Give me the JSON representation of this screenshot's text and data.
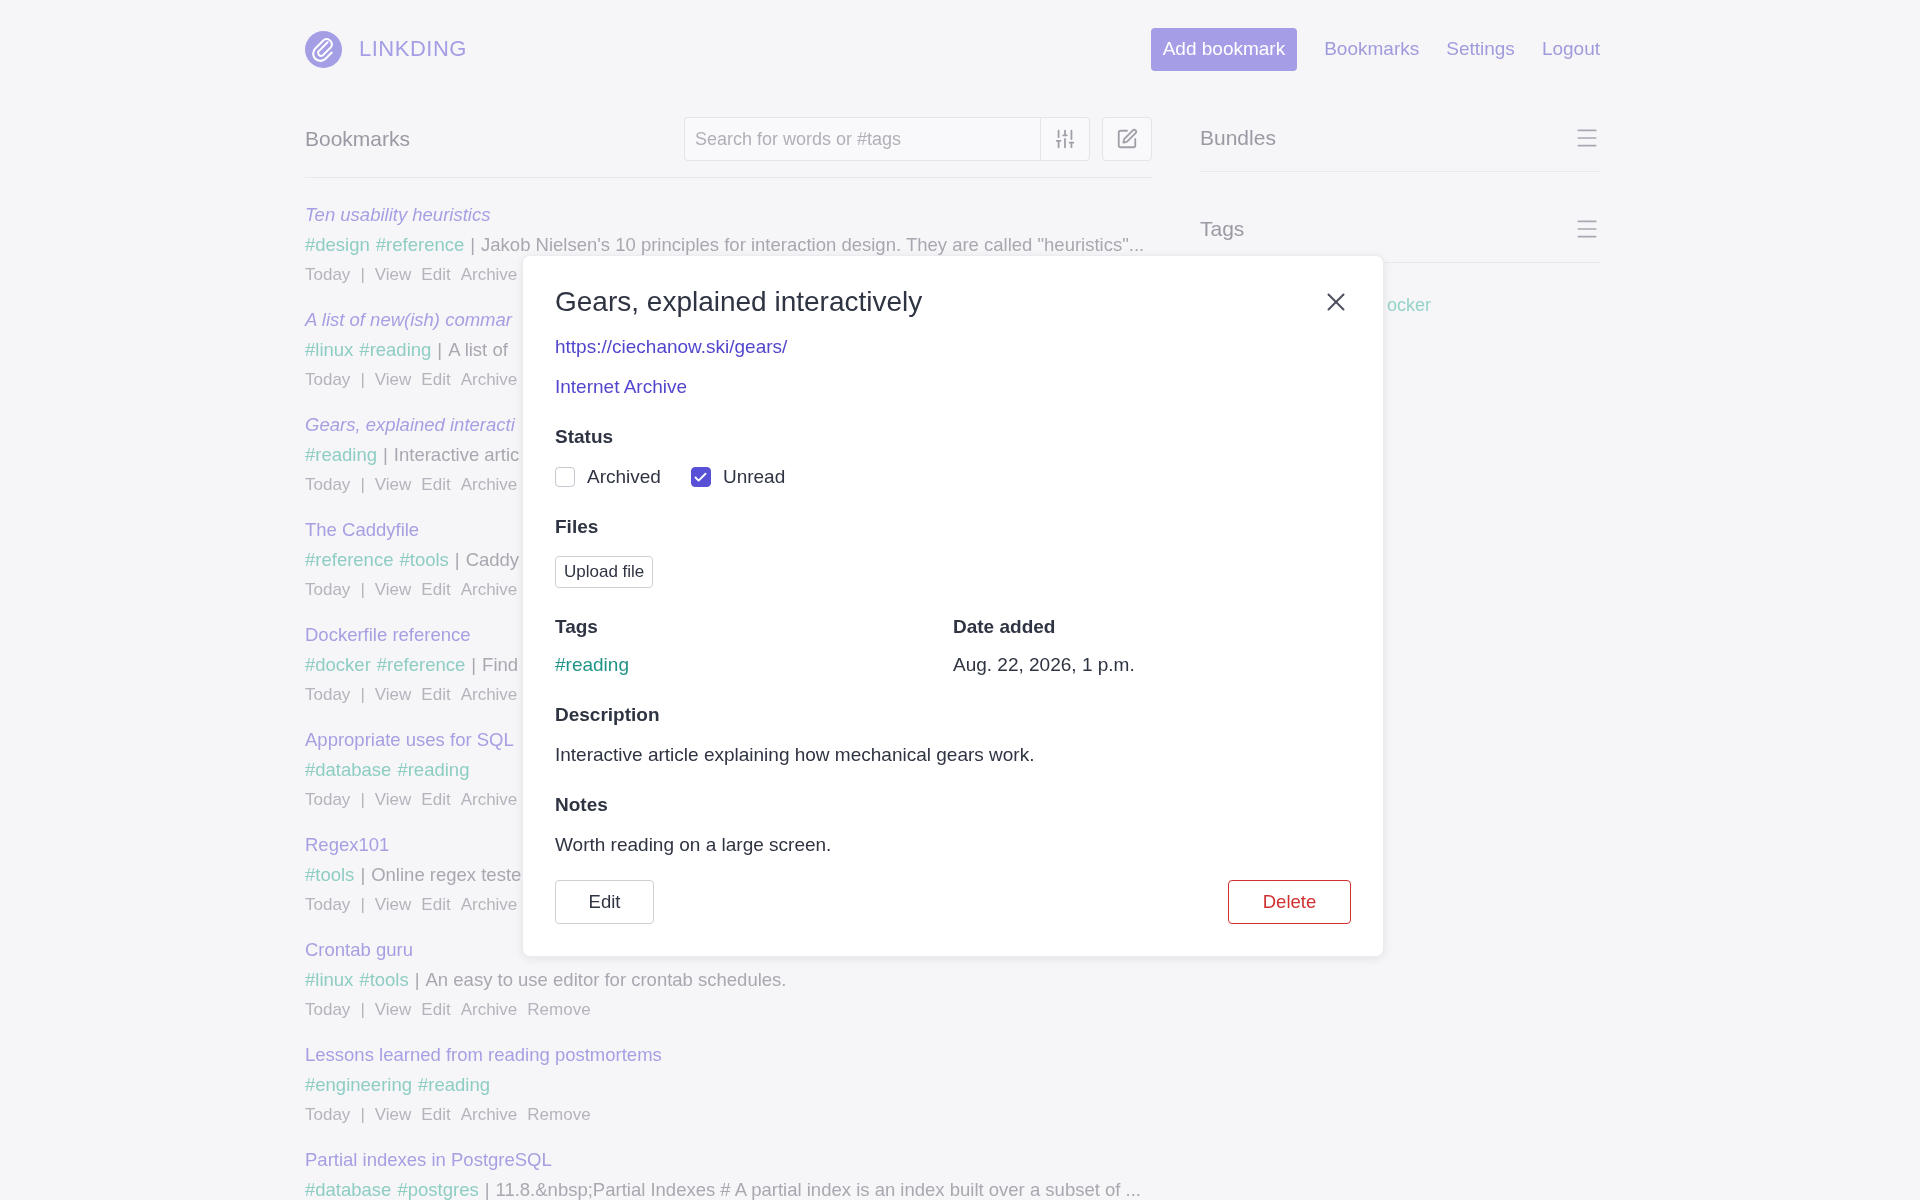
{
  "header": {
    "logo_text": "LINKDING",
    "nav": [
      {
        "label": "Add bookmark",
        "kind": "button"
      },
      {
        "label": "Bookmarks",
        "kind": "link"
      },
      {
        "label": "Settings",
        "kind": "link"
      },
      {
        "label": "Logout",
        "kind": "link"
      }
    ]
  },
  "bookmarks": {
    "heading": "Bookmarks",
    "search": {
      "placeholder": "Search for words or #tags"
    },
    "separator": "|",
    "items": [
      {
        "title": "Ten usability heuristics",
        "unread": true,
        "tags": [
          "#design",
          "#reference"
        ],
        "description": "Jakob Nielsen's 10 principles for interaction design. They are called \"heuristics\"...",
        "date": "Today",
        "actions": [
          "View",
          "Edit",
          "Archive"
        ]
      },
      {
        "title": "A list of new(ish) commar",
        "unread": true,
        "tags": [
          "#linux",
          "#reading"
        ],
        "description": "A list of",
        "date": "Today",
        "actions": [
          "View",
          "Edit",
          "Archive"
        ]
      },
      {
        "title": "Gears, explained interacti",
        "unread": true,
        "tags": [
          "#reading"
        ],
        "description": "Interactive artic",
        "date": "Today",
        "actions": [
          "View",
          "Edit",
          "Archive"
        ]
      },
      {
        "title": "The Caddyfile",
        "unread": false,
        "tags": [
          "#reference",
          "#tools"
        ],
        "description": "Caddy",
        "date": "Today",
        "actions": [
          "View",
          "Edit",
          "Archive"
        ]
      },
      {
        "title": "Dockerfile reference",
        "unread": false,
        "tags": [
          "#docker",
          "#reference"
        ],
        "description": "Find",
        "date": "Today",
        "actions": [
          "View",
          "Edit",
          "Archive"
        ]
      },
      {
        "title": "Appropriate uses for SQL",
        "unread": false,
        "tags": [
          "#database",
          "#reading"
        ],
        "date": "Today",
        "actions": [
          "View",
          "Edit",
          "Archive"
        ]
      },
      {
        "title": "Regex101",
        "unread": false,
        "tags": [
          "#tools"
        ],
        "description": "Online regex teste",
        "date": "Today",
        "actions": [
          "View",
          "Edit",
          "Archive"
        ]
      },
      {
        "title": "Crontab guru",
        "unread": false,
        "tags": [
          "#linux",
          "#tools"
        ],
        "description": "An easy to use editor for crontab schedules.",
        "date": "Today",
        "actions": [
          "View",
          "Edit",
          "Archive",
          "Remove"
        ]
      },
      {
        "title": "Lessons learned from reading postmortems",
        "unread": false,
        "tags": [
          "#engineering",
          "#reading"
        ],
        "date": "Today",
        "actions": [
          "View",
          "Edit",
          "Archive",
          "Remove"
        ]
      },
      {
        "title": "Partial indexes in PostgreSQL",
        "unread": false,
        "tags": [
          "#database",
          "#postgres"
        ],
        "description": "11.8.&nbsp;Partial Indexes # A partial index is an index built over a subset of ..."
      }
    ]
  },
  "sidebar": {
    "sections": [
      {
        "title": "Bundles"
      },
      {
        "title": "Tags"
      }
    ],
    "tags": [
      "ocker"
    ]
  },
  "modal": {
    "title": "Gears, explained interactively",
    "url": "https://ciechanow.ski/gears/",
    "archive_link": "Internet Archive",
    "status": {
      "label": "Status",
      "options": [
        {
          "label": "Archived",
          "checked": false
        },
        {
          "label": "Unread",
          "checked": true
        }
      ]
    },
    "files": {
      "label": "Files",
      "button": "Upload file"
    },
    "tags": {
      "label": "Tags",
      "items": [
        "#reading"
      ]
    },
    "date": {
      "label": "Date added",
      "value": "Aug. 22, 2026, 1 p.m."
    },
    "description": {
      "label": "Description",
      "text": "Interactive article explaining how mechanical gears work."
    },
    "notes": {
      "label": "Notes",
      "text": "Worth reading on a large screen."
    },
    "buttons": {
      "edit": "Edit",
      "delete": "Delete"
    }
  }
}
